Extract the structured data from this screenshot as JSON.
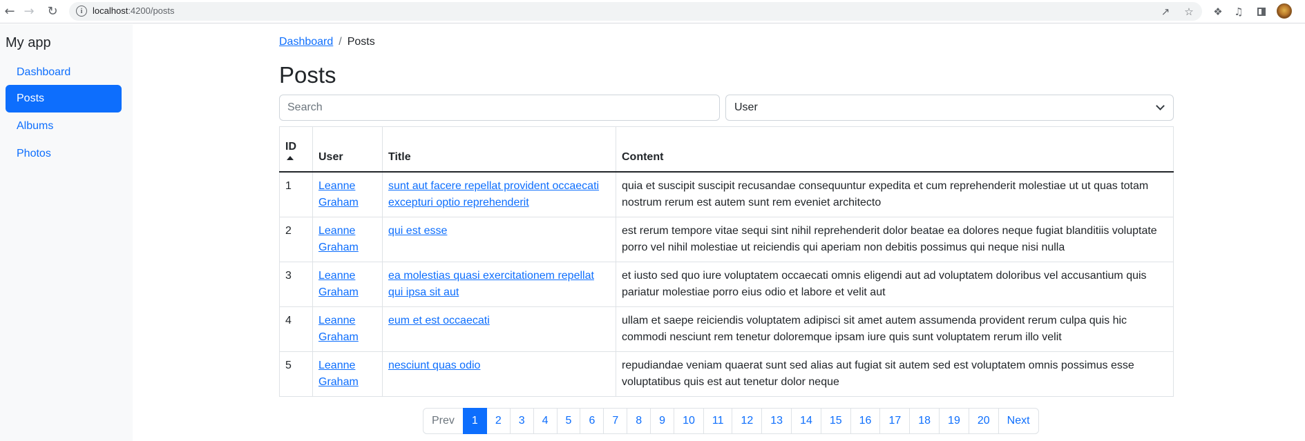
{
  "browser": {
    "url_host": "localhost",
    "url_rest": ":4200/posts",
    "icons": [
      "back-icon",
      "forward-icon",
      "reload-icon",
      "site-info-icon",
      "share-icon",
      "bookmark-star-icon",
      "extensions-icon",
      "media-icon",
      "side-panel-icon",
      "profile-avatar"
    ]
  },
  "sidebar": {
    "brand": "My app",
    "items": [
      {
        "label": "Dashboard",
        "active": false
      },
      {
        "label": "Posts",
        "active": true
      },
      {
        "label": "Albums",
        "active": false
      },
      {
        "label": "Photos",
        "active": false
      }
    ]
  },
  "breadcrumb": {
    "parent": "Dashboard",
    "separator": "/",
    "current": "Posts"
  },
  "page": {
    "title": "Posts"
  },
  "filters": {
    "search_placeholder": "Search",
    "search_value": "",
    "user_select_value": "User"
  },
  "table": {
    "columns": [
      "ID",
      "User",
      "Title",
      "Content"
    ],
    "sort": {
      "column": "ID",
      "direction": "ascending"
    },
    "rows": [
      {
        "id": "1",
        "user": "Leanne Graham",
        "title": "sunt aut facere repellat provident occaecati excepturi optio reprehenderit",
        "content": "quia et suscipit suscipit recusandae consequuntur expedita et cum reprehenderit molestiae ut ut quas totam nostrum rerum est autem sunt rem eveniet architecto"
      },
      {
        "id": "2",
        "user": "Leanne Graham",
        "title": "qui est esse",
        "content": "est rerum tempore vitae sequi sint nihil reprehenderit dolor beatae ea dolores neque fugiat blanditiis voluptate porro vel nihil molestiae ut reiciendis qui aperiam non debitis possimus qui neque nisi nulla"
      },
      {
        "id": "3",
        "user": "Leanne Graham",
        "title": "ea molestias quasi exercitationem repellat qui ipsa sit aut",
        "content": "et iusto sed quo iure voluptatem occaecati omnis eligendi aut ad voluptatem doloribus vel accusantium quis pariatur molestiae porro eius odio et labore et velit aut"
      },
      {
        "id": "4",
        "user": "Leanne Graham",
        "title": "eum et est occaecati",
        "content": "ullam et saepe reiciendis voluptatem adipisci sit amet autem assumenda provident rerum culpa quis hic commodi nesciunt rem tenetur doloremque ipsam iure quis sunt voluptatem rerum illo velit"
      },
      {
        "id": "5",
        "user": "Leanne Graham",
        "title": "nesciunt quas odio",
        "content": "repudiandae veniam quaerat sunt sed alias aut fugiat sit autem sed est voluptatem omnis possimus esse voluptatibus quis est aut tenetur dolor neque"
      }
    ]
  },
  "pagination": {
    "prev_label": "Prev",
    "next_label": "Next",
    "prev_disabled": true,
    "current_page": 1,
    "pages": [
      "1",
      "2",
      "3",
      "4",
      "5",
      "6",
      "7",
      "8",
      "9",
      "10",
      "11",
      "12",
      "13",
      "14",
      "15",
      "16",
      "17",
      "18",
      "19",
      "20"
    ]
  },
  "colors": {
    "primary": "#0d6efd",
    "sidebar_bg": "#f8f9fa",
    "text": "#212529",
    "border": "#dee2e6"
  }
}
